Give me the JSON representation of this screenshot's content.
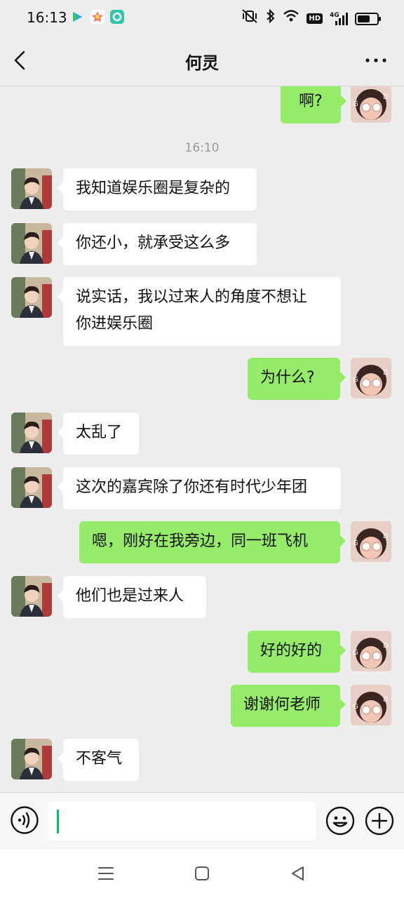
{
  "status_bar": {
    "time": "16:13",
    "app_icons": [
      "video-app-icon",
      "star-app-icon",
      "ring-app-icon"
    ],
    "network_badge": "HD",
    "network_type": "4G"
  },
  "header": {
    "title": "何灵",
    "back_icon": "chevron-left-icon",
    "more_icon": "more-dots-icon"
  },
  "chat": {
    "messages": [
      {
        "from": "me",
        "text": "啊?"
      },
      {
        "type": "time",
        "text": "16:10"
      },
      {
        "from": "other",
        "text": "我知道娱乐圈是复杂的"
      },
      {
        "from": "other",
        "text": "你还小，就承受这么多"
      },
      {
        "from": "other",
        "lines": [
          "说实话，我以过来人的角度不想让",
          "你进娱乐圈"
        ]
      },
      {
        "from": "me",
        "text": "为什么?"
      },
      {
        "from": "other",
        "text": "太乱了"
      },
      {
        "from": "other",
        "text": "这次的嘉宾除了你还有时代少年团"
      },
      {
        "from": "me",
        "text": "嗯，刚好在我旁边，同一班飞机"
      },
      {
        "from": "other",
        "text": "他们也是过来人"
      },
      {
        "from": "me",
        "text": "好的好的"
      },
      {
        "from": "me",
        "text": "谢谢何老师"
      },
      {
        "from": "other",
        "text": "不客气"
      }
    ]
  },
  "input_bar": {
    "voice_icon": "voice-icon",
    "emoji_icon": "emoji-icon",
    "plus_icon": "plus-icon",
    "value": ""
  },
  "nav_bar": {
    "icons": [
      "menu-icon",
      "home-square-icon",
      "back-triangle-icon"
    ]
  },
  "colors": {
    "background": "#ededed",
    "outgoing_bubble": "#95ec69",
    "incoming_bubble": "#ffffff",
    "caret": "#07c160"
  }
}
